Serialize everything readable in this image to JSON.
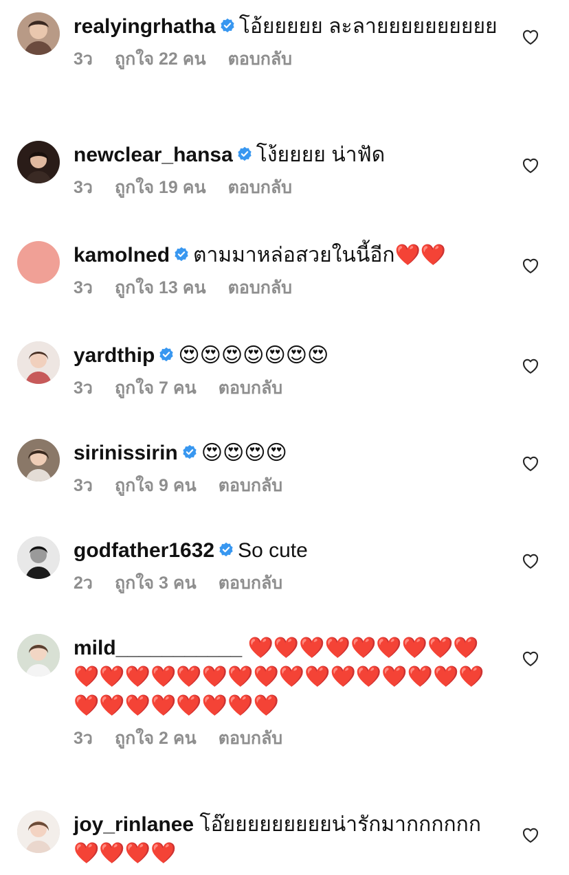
{
  "colors": {
    "verified": "#3897f0",
    "meta": "#8e8e8e",
    "heart_red": "#e8202e"
  },
  "comments": [
    {
      "username": "realyingrhatha",
      "text": "โอ้ยยยยย ละลายยยยยยยยยย",
      "time": "3ว",
      "likes": "ถูกใจ 22 คน",
      "reply": "ตอบกลับ"
    },
    {
      "username": "newclear_hansa",
      "text": "โง้ยยยย น่าฟัด",
      "time": "3ว",
      "likes": "ถูกใจ 19 คน",
      "reply": "ตอบกลับ"
    },
    {
      "username": "kamolned",
      "text": "ตามมาหล่อสวยในนี้อีก❤️❤️",
      "time": "3ว",
      "likes": "ถูกใจ 13 คน",
      "reply": "ตอบกลับ"
    },
    {
      "username": "yardthip",
      "text": "😍😍😍😍😍😍😍",
      "time": "3ว",
      "likes": "ถูกใจ 7 คน",
      "reply": "ตอบกลับ"
    },
    {
      "username": "sirinissirin",
      "text": "😍😍😍😍",
      "time": "3ว",
      "likes": "ถูกใจ 9 คน",
      "reply": "ตอบกลับ"
    },
    {
      "username": "godfather1632",
      "text": "So cute",
      "time": "2ว",
      "likes": "ถูกใจ 3 คน",
      "reply": "ตอบกลับ"
    },
    {
      "username": "mild___________",
      "text": "❤️❤️❤️❤️❤️❤️❤️❤️❤️❤️❤️❤️❤️❤️❤️❤️❤️❤️❤️❤️❤️❤️❤️❤️❤️❤️❤️❤️❤️❤️❤️❤️❤️",
      "time": "3ว",
      "likes": "ถูกใจ 2 คน",
      "reply": "ตอบกลับ"
    },
    {
      "username": "joy_rinlanee",
      "text": "โอ๊ยยยยยยยยยน่ารักมากกกกกก❤️❤️❤️❤️",
      "time": "",
      "likes": "",
      "reply": ""
    }
  ]
}
